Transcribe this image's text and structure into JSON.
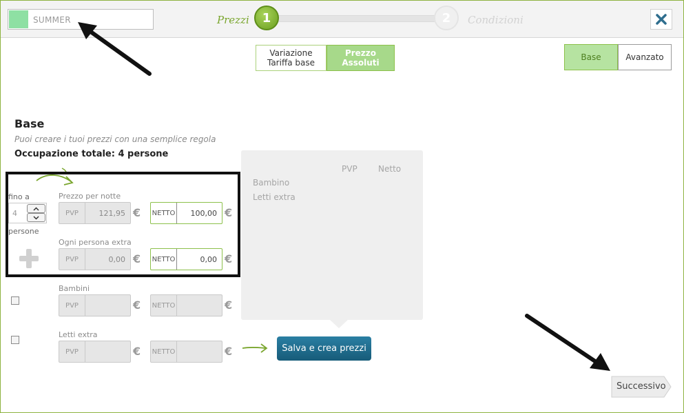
{
  "header": {
    "rate_name": "SUMMER",
    "step1": {
      "number": "1",
      "label": "Prezzi"
    },
    "step2": {
      "number": "2",
      "label": "Condizioni"
    }
  },
  "mode_toggle": {
    "option1_line1": "Variazione",
    "option1_line2": "Tariffa base",
    "option2_line1": "Prezzo",
    "option2_line2": "Assoluti"
  },
  "level_toggle": {
    "option1": "Base",
    "option2": "Avanzato"
  },
  "section": {
    "title": "Base",
    "subtitle": "Puoi creare i tuoi prezzi con una semplice regola",
    "occupancy": "Occupazione totale: 4 persone"
  },
  "occupancy_stepper": {
    "prefix": "fino a",
    "value": "4",
    "suffix": "persone"
  },
  "rows": {
    "per_night": {
      "label": "Prezzo per notte",
      "pvp_tag": "PVP",
      "pvp_value": "121,95",
      "net_tag": "NETTO",
      "net_value": "100,00"
    },
    "extra_person": {
      "label": "Ogni persona extra",
      "pvp_tag": "PVP",
      "pvp_value": "0,00",
      "net_tag": "NETTO",
      "net_value": "0,00"
    },
    "children": {
      "label": "Bambini",
      "pvp_tag": "PVP",
      "pvp_value": "",
      "net_tag": "NETTO",
      "net_value": ""
    },
    "extra_beds": {
      "label": "Letti extra",
      "pvp_tag": "PVP",
      "pvp_value": "",
      "net_tag": "NETTO",
      "net_value": ""
    }
  },
  "currency": "€",
  "preview": {
    "col_pvp": "PVP",
    "col_net": "Netto",
    "row_children": "Bambino",
    "row_beds": "Letti extra"
  },
  "actions": {
    "save": "Salva e crea prezzi",
    "next": "Successivo"
  },
  "colors": {
    "accent": "#8cc04a",
    "primary_button": "#1e6b8c",
    "close_icon": "#2f6e8e",
    "swatch": "#8ee0a3"
  }
}
